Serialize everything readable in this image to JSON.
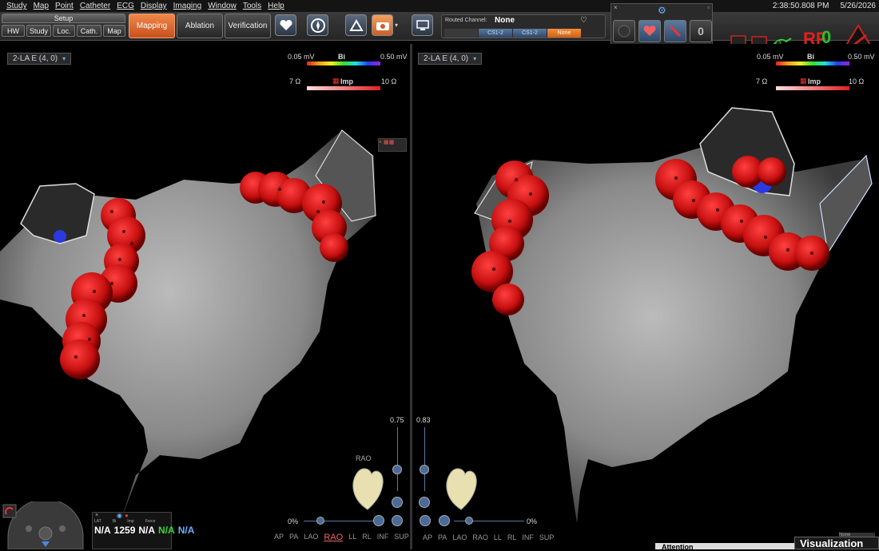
{
  "menu": [
    "Study",
    "Map",
    "Point",
    "Catheter",
    "ECG",
    "Display",
    "Imaging",
    "Window",
    "Tools",
    "Help"
  ],
  "clock": {
    "time": "2:38:50.808 PM",
    "date": "5/26/2026"
  },
  "setup": {
    "title": "Setup",
    "buttons": [
      "HW",
      "Study",
      "Loc.",
      "Cath.",
      "Map"
    ]
  },
  "workflow": [
    {
      "label": "Mapping",
      "active": true
    },
    {
      "label": "Ablation",
      "active": false
    },
    {
      "label": "Verification",
      "active": false
    }
  ],
  "routed": {
    "label": "Routed Channel:",
    "value": "None",
    "channels": [
      "",
      "CS1-2",
      "CS1-2",
      "None"
    ]
  },
  "right_status": {
    "rf": "RF",
    "zero": "0"
  },
  "left_view": {
    "map_label": "2-LA E (4, 0)",
    "bi": {
      "min": "0.05 mV",
      "name": "Bi",
      "max": "0.50 mV"
    },
    "imp": {
      "min": "7 Ω",
      "name": "Imp",
      "max": "10 Ω"
    },
    "opacity": "0.75",
    "pct": "0%",
    "orientation": "RAO",
    "views": [
      "AP",
      "PA",
      "LAO",
      "RAO",
      "LL",
      "RL",
      "INF",
      "SUP"
    ]
  },
  "right_view": {
    "map_label": "2-LA E (4, 0)",
    "bi": {
      "min": "0.05 mV",
      "name": "Bi",
      "max": "0.50 mV"
    },
    "imp": {
      "min": "7 Ω",
      "name": "Imp",
      "max": "10 Ω"
    },
    "opacity": "0.83",
    "pct": "0%",
    "views": [
      "AP",
      "PA",
      "LAO",
      "RAO",
      "LL",
      "RL",
      "INF",
      "SUP"
    ]
  },
  "mini": {
    "headers": [
      "LAT",
      "Bi",
      "Imp",
      "Force"
    ],
    "values": [
      "N/A",
      "1259",
      "N/A",
      "N/A",
      "N/A"
    ]
  },
  "bottom": {
    "attention": "Attention",
    "visualization": "Visualization",
    "none": "None"
  },
  "colors": {
    "accent": "#e8743a",
    "lesion": "#d01818"
  }
}
